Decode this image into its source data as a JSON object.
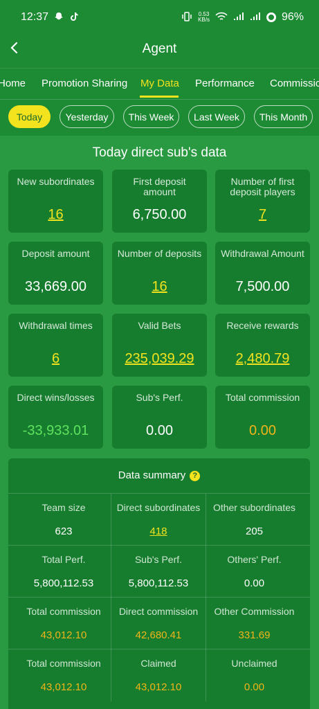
{
  "status_bar": {
    "time": "12:37",
    "net_speed_value": "0.53",
    "net_speed_unit": "KB/s",
    "battery": "96%",
    "icons": [
      "snapchat-icon",
      "tiktok-icon",
      "vibrate-icon",
      "wifi-icon",
      "signal-icon",
      "battery-icon"
    ]
  },
  "header": {
    "title": "Agent"
  },
  "tabs": [
    {
      "label": "Home"
    },
    {
      "label": "Promotion Sharing"
    },
    {
      "label": "My Data",
      "active": true
    },
    {
      "label": "Performance"
    },
    {
      "label": "Commission"
    }
  ],
  "periods": [
    {
      "label": "Today",
      "active": true
    },
    {
      "label": "Yesterday"
    },
    {
      "label": "This Week"
    },
    {
      "label": "Last Week"
    },
    {
      "label": "This Month"
    }
  ],
  "section_title": "Today direct sub's data",
  "cards": [
    {
      "label": "New subordinates",
      "value": "16"
    },
    {
      "label": "First deposit amount",
      "value": "6,750.00"
    },
    {
      "label": "Number of first deposit players",
      "value": "7"
    },
    {
      "label": "Deposit amount",
      "value": "33,669.00"
    },
    {
      "label": "Number of deposits",
      "value": "16"
    },
    {
      "label": "Withdrawal Amount",
      "value": "7,500.00"
    },
    {
      "label": "Withdrawal times",
      "value": "6"
    },
    {
      "label": "Valid Bets",
      "value": "235,039.29"
    },
    {
      "label": "Receive rewards",
      "value": "2,480.79"
    },
    {
      "label": "Direct wins/losses",
      "value": "-33,933.01"
    },
    {
      "label": "Sub's Perf.",
      "value": "0.00"
    },
    {
      "label": "Total commission",
      "value": "0.00"
    }
  ],
  "summary": {
    "title": "Data summary",
    "rows": [
      [
        {
          "label": "Team size",
          "value": "623"
        },
        {
          "label": "Direct subordinates",
          "value": "418"
        },
        {
          "label": "Other subordinates",
          "value": "205"
        }
      ],
      [
        {
          "label": "Total Perf.",
          "value": "5,800,112.53"
        },
        {
          "label": "Sub's Perf.",
          "value": "5,800,112.53"
        },
        {
          "label": "Others' Perf.",
          "value": "0.00"
        }
      ],
      [
        {
          "label": "Total commission",
          "value": "43,012.10"
        },
        {
          "label": "Direct commission",
          "value": "42,680.41"
        },
        {
          "label": "Other Commission",
          "value": "331.69"
        }
      ],
      [
        {
          "label": "Total commission",
          "value": "43,012.10"
        },
        {
          "label": "Claimed",
          "value": "43,012.10"
        },
        {
          "label": "Unclaimed",
          "value": "0.00"
        }
      ]
    ]
  },
  "colors": {
    "background": "#1d8a34",
    "panel": "#2a9a42",
    "card": "#167d2e",
    "accent_yellow": "#f3e21e",
    "gold": "#f0b419",
    "positive_green": "#5fe25f"
  }
}
